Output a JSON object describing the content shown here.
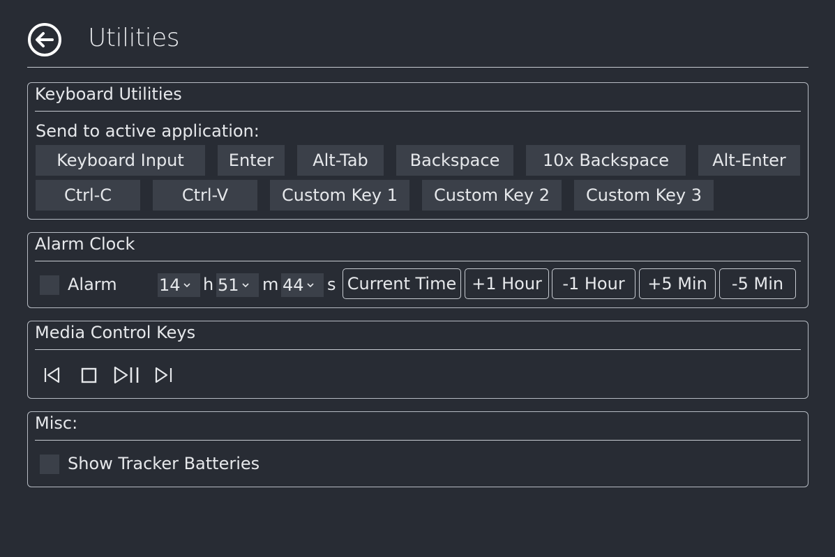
{
  "header": {
    "title": "Utilities"
  },
  "keyboard": {
    "title": "Keyboard Utilities",
    "send_label": "Send to active application:",
    "row1": [
      "Keyboard Input",
      "Enter",
      "Alt-Tab",
      "Backspace",
      "10x Backspace",
      "Alt-Enter"
    ],
    "row2": [
      "Ctrl-C",
      "Ctrl-V",
      "Custom Key 1",
      "Custom Key 2",
      "Custom Key 3"
    ]
  },
  "alarm": {
    "title": "Alarm Clock",
    "checkbox_label": "Alarm",
    "hours": "14",
    "minutes": "51",
    "seconds": "44",
    "unit_h": "h",
    "unit_m": "m",
    "unit_s": "s",
    "buttons": [
      "Current Time",
      "+1 Hour",
      "-1 Hour",
      "+5 Min",
      "-5 Min"
    ]
  },
  "media": {
    "title": "Media Control Keys",
    "icons": [
      "previous-track-icon",
      "stop-icon",
      "play-pause-icon",
      "next-track-icon"
    ]
  },
  "misc": {
    "title": "Misc:",
    "checkbox_label": "Show Tracker Batteries"
  }
}
